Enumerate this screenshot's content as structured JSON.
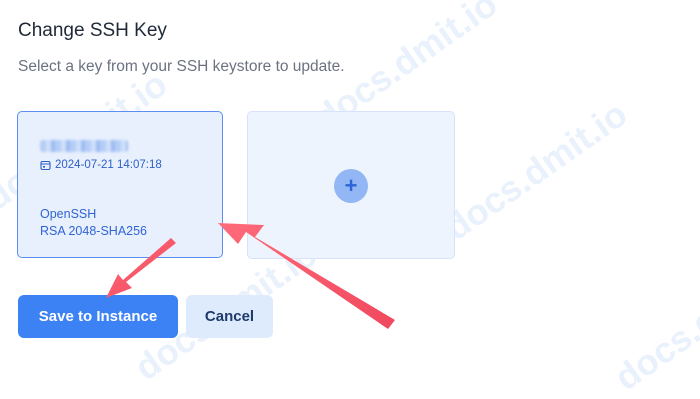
{
  "dialog": {
    "title": "Change SSH Key",
    "subtitle": "Select a key from your SSH keystore to update."
  },
  "key_card": {
    "date": "2024-07-21 14:07:18",
    "type_line1": "OpenSSH",
    "type_line2": "RSA 2048-SHA256"
  },
  "add_card": {
    "icon": "plus-icon",
    "symbol": "+"
  },
  "buttons": {
    "save_label": "Save to Instance",
    "cancel_label": "Cancel"
  },
  "watermark": "docs.dmit.io",
  "colors": {
    "primary": "#3d82f5",
    "card_selected_bg": "#e8f0fd",
    "arrow": "#f25b6e"
  }
}
